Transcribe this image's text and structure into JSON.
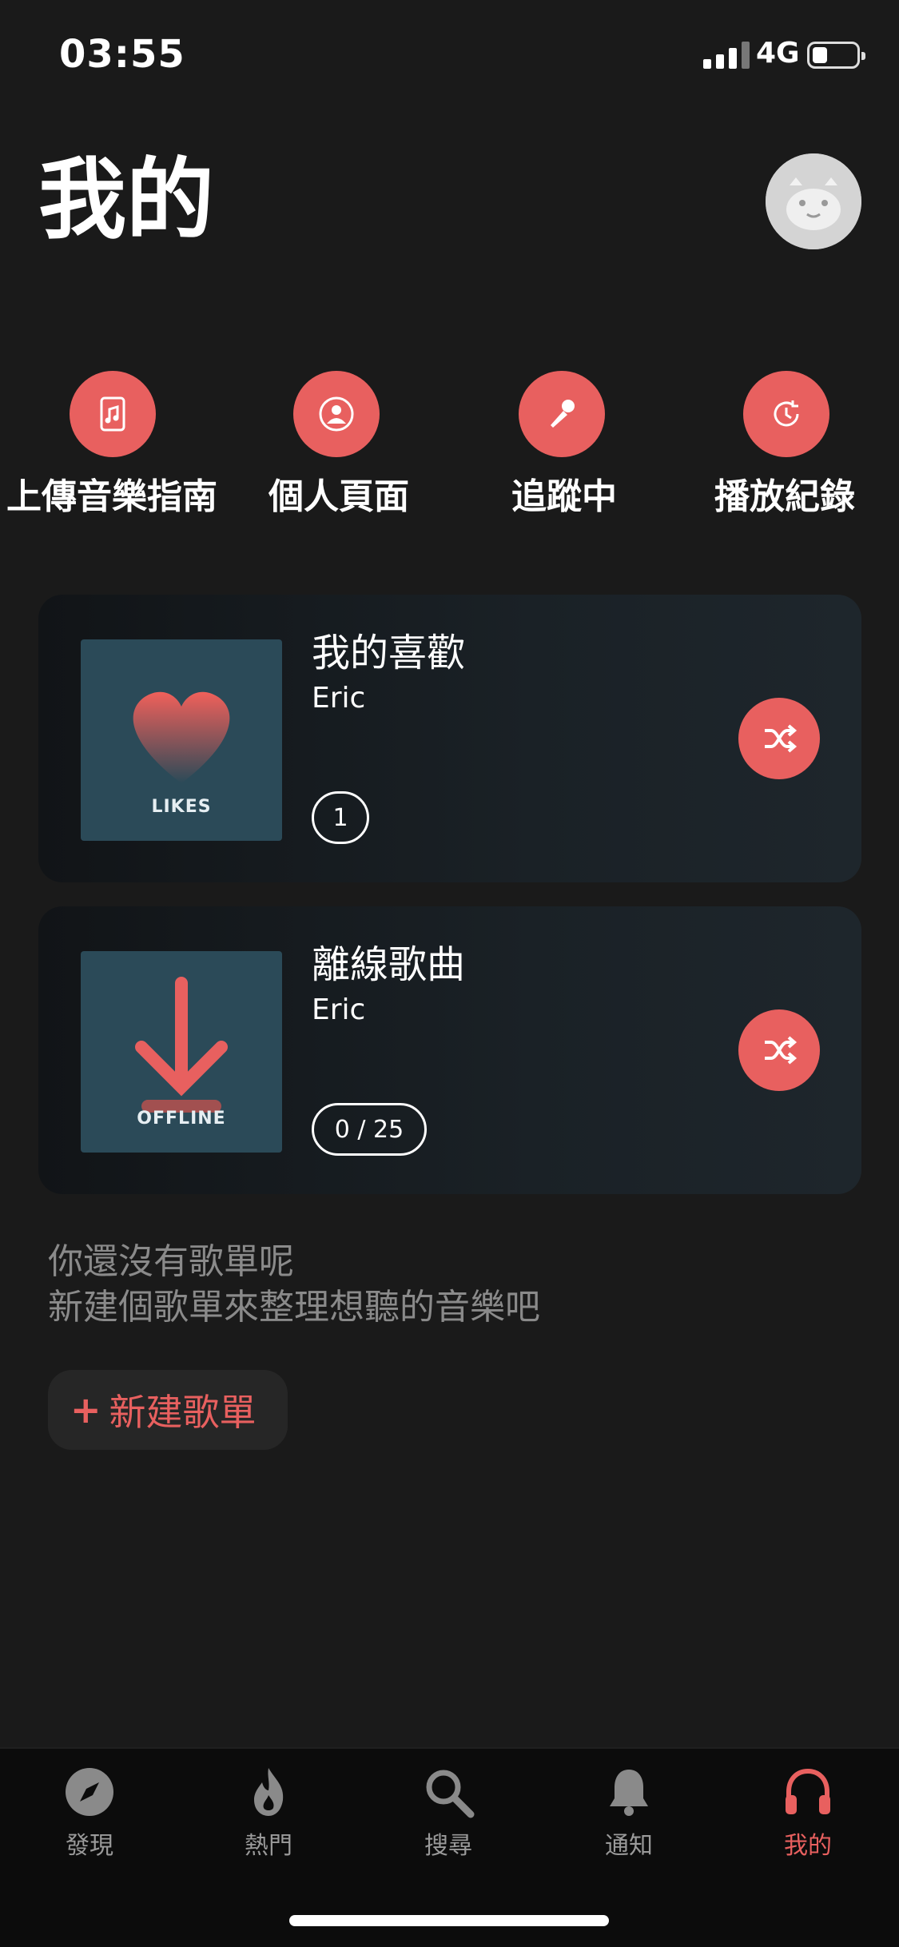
{
  "status": {
    "time": "03:55",
    "network": "4G"
  },
  "header": {
    "title": "我的"
  },
  "quick_actions": [
    {
      "label": "上傳音樂指南",
      "icon": "music-file-icon"
    },
    {
      "label": "個人頁面",
      "icon": "user-icon"
    },
    {
      "label": "追蹤中",
      "icon": "microphone-icon"
    },
    {
      "label": "播放紀錄",
      "icon": "history-icon"
    }
  ],
  "playlists": [
    {
      "title": "我的喜歡",
      "owner": "Eric",
      "count": "1",
      "cover_label": "LIKES"
    },
    {
      "title": "離線歌曲",
      "owner": "Eric",
      "count": "0 / 25",
      "cover_label": "OFFLINE"
    }
  ],
  "empty": {
    "line1": "你還沒有歌單呢",
    "line2": "新建個歌單來整理想聽的音樂吧"
  },
  "new_playlist": {
    "plus": "+",
    "label": "新建歌單"
  },
  "tabs": [
    {
      "label": "發現",
      "icon": "compass-icon"
    },
    {
      "label": "熱門",
      "icon": "fire-icon"
    },
    {
      "label": "搜尋",
      "icon": "search-icon"
    },
    {
      "label": "通知",
      "icon": "bell-icon"
    },
    {
      "label": "我的",
      "icon": "headphones-icon"
    }
  ],
  "colors": {
    "accent": "#e8605f",
    "background": "#1a1a1a",
    "tabbar": "#0c0c0c"
  }
}
